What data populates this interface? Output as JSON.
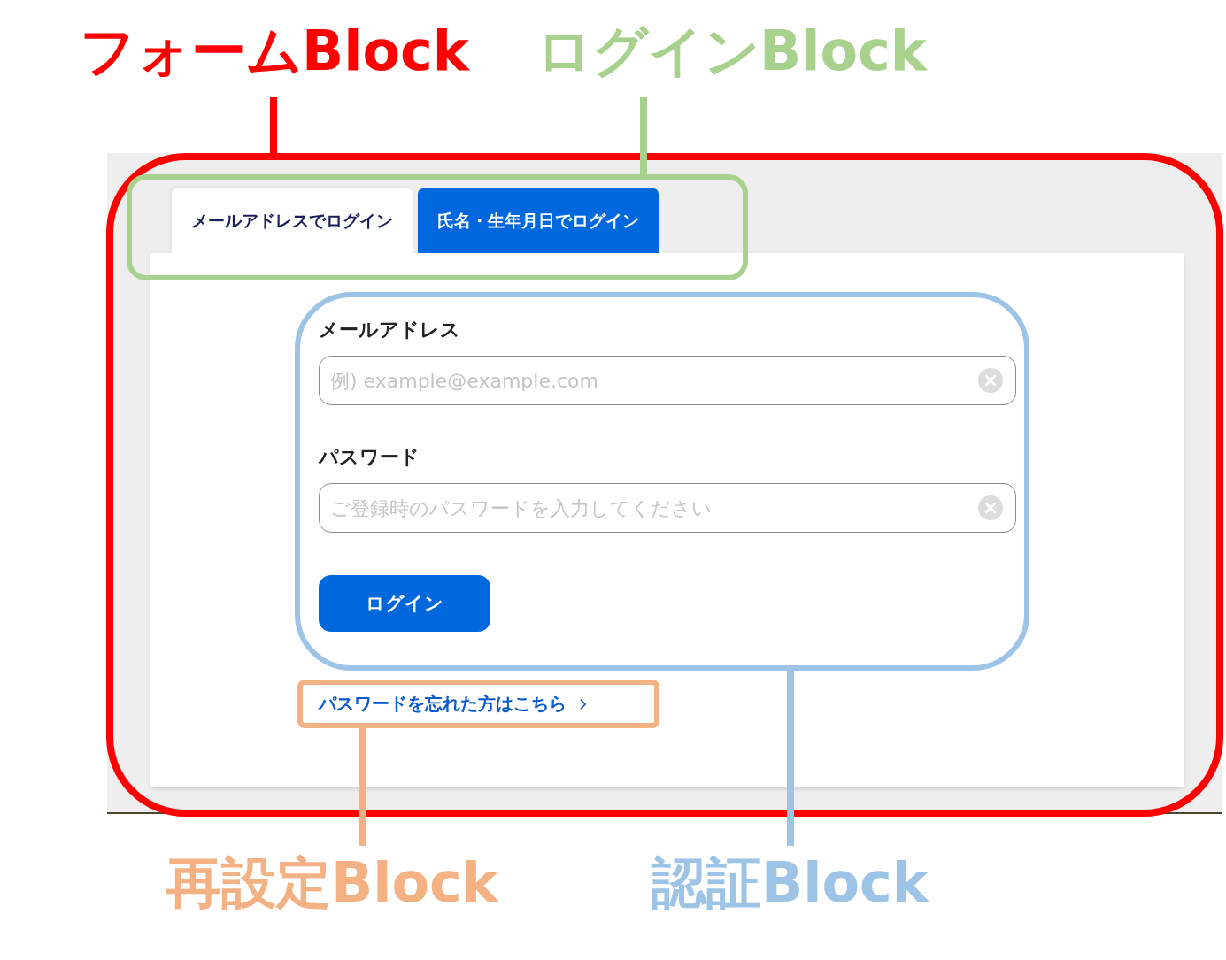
{
  "tabs": [
    {
      "label": "メールアドレスでログイン",
      "selected": true
    },
    {
      "label": "氏名・生年月日でログイン",
      "selected": false
    }
  ],
  "fields": [
    {
      "label": "メールアドレス",
      "placeholder": "例) example@example.com"
    },
    {
      "label": "パスワード",
      "placeholder": "ご登録時のパスワードを入力してください"
    }
  ],
  "login_button": "ログイン",
  "forgot_link": "パスワードを忘れた方はこちら",
  "annotations": [
    {
      "label": "フォームBlock",
      "color": "#ff0000"
    },
    {
      "label": "ログインBlock",
      "color": "#a9d18e"
    },
    {
      "label": "再設定Block",
      "color": "#f4b183"
    },
    {
      "label": "認証Block",
      "color": "#9dc3e6"
    }
  ]
}
